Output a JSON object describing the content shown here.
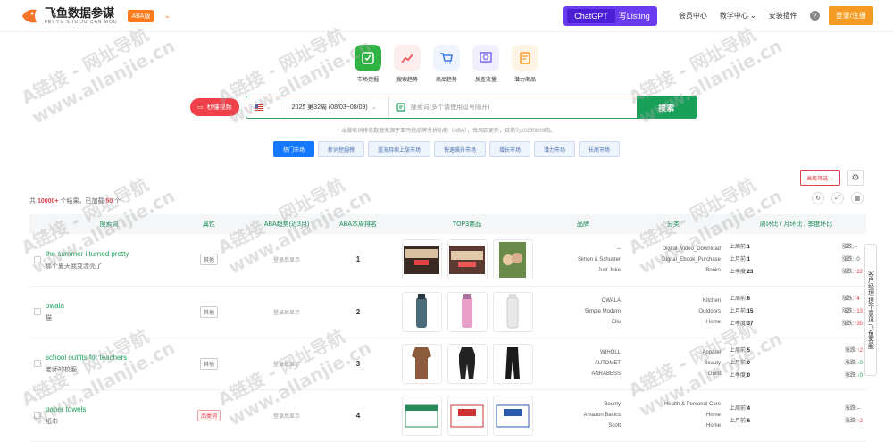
{
  "header": {
    "brand_name": "飞鱼数据参谋",
    "brand_sub": "FEI YU SHU JU CAN MOU",
    "aba_badge": "ABA版",
    "chatgpt": "ChatGPT",
    "write_listing": "写Listing",
    "nav": [
      "会员中心",
      "教学中心",
      "安装插件"
    ],
    "login": "登录/注册"
  },
  "tools": [
    {
      "label": "市场挖掘",
      "color": "#2fb344",
      "bg": "#2fb344",
      "icon": "market-icon"
    },
    {
      "label": "搜索趋势",
      "color": "#f05a5a",
      "bg": "#fdeeee",
      "icon": "trend-icon"
    },
    {
      "label": "商品趋势",
      "color": "#3b7be8",
      "bg": "#eef3fd",
      "icon": "cart-icon"
    },
    {
      "label": "反查流量",
      "color": "#7a6af0",
      "bg": "#f1effd",
      "icon": "reverse-icon"
    },
    {
      "label": "潜力商品",
      "color": "#f59a23",
      "bg": "#fef4e6",
      "icon": "potential-icon"
    }
  ],
  "search": {
    "video_btn": "秒懂视频",
    "week": "2025 第32周 (08/03~08/09)",
    "placeholder": "搜索词(多个请使用逗号隔开)",
    "button": "搜索"
  },
  "notice": "* 本搜索词排名数据来源于亚马逊品牌分析功能（ABA），每周四更新，目前为20250809期。",
  "tabs": [
    "热门市场",
    "新词挖掘榜",
    "蓝海持续上涨市场",
    "快速飙升市场",
    "增长市场",
    "潜力市场",
    "长尾市场"
  ],
  "filter_btn": "高级筛选",
  "stats": {
    "prefix": "共",
    "total": "10000+",
    "mid": "个结果，已加载",
    "loaded": "50",
    "suffix": "个"
  },
  "columns": [
    "",
    "搜索词",
    "属性",
    "ABA趋势(近3月)",
    "ABA本周排名",
    "TOP3商品",
    "品牌",
    "分类",
    "周环比 / 月环比 / 季度环比"
  ],
  "rows": [
    {
      "kw": "the summer i turned pretty",
      "cn": "那个夏天我变漂亮了",
      "attr": "其他",
      "attr_red": false,
      "trend": "登录后显示",
      "rank": "1",
      "brands": [
        "--",
        "Simon & Schuster",
        "Just Juke"
      ],
      "cats": [
        "Digital_Video_Download",
        "Digital_Ebook_Purchase",
        "Books"
      ],
      "r1": "1",
      "r2": "1",
      "r3": "23",
      "c1": "--",
      "c2": "0",
      "c3": "22",
      "d2": "dn",
      "d3": "up"
    },
    {
      "kw": "owala",
      "cn": "猫",
      "attr": "其他",
      "attr_red": false,
      "trend": "登录后显示",
      "rank": "2",
      "brands": [
        "OWALA",
        "Simple Modern",
        "Ello"
      ],
      "cats": [
        "Kitchen",
        "Outdoors",
        "Home"
      ],
      "r1": "6",
      "r2": "15",
      "r3": "37",
      "c1": "4",
      "c2": "13",
      "c3": "35",
      "d2": "up",
      "d3": "up"
    },
    {
      "kw": "school outfits for teachers",
      "cn": "老师的校服",
      "attr": "其他",
      "attr_red": false,
      "trend": "登录后显示",
      "rank": "3",
      "brands": [
        "WIHOLL",
        "AUTOMET",
        "ANRABESS"
      ],
      "cats": [
        "Apparel",
        "Beauty",
        "Guild"
      ],
      "r1": "5",
      "r2": "0",
      "r3": "0",
      "c1": "2",
      "c2": "0",
      "c3": "0",
      "d2": "dn",
      "d3": "dn"
    },
    {
      "kw": "paper towels",
      "cn": "纸巾",
      "attr": "品类词",
      "attr_red": true,
      "trend": "登录后显示",
      "rank": "4",
      "brands": [
        "Bounty",
        "Amazon Basics",
        "Scott"
      ],
      "cats": [
        "Health & Personal Care",
        "Home",
        "Home"
      ],
      "r1": "4",
      "r2": "6",
      "r3": "",
      "c1": "--",
      "c2": "2",
      "c3": "",
      "d2": "up",
      "d3": "up"
    }
  ],
  "side_panel": "客户经理 提个意见 飞鱼客服",
  "watermark": "A链接 - 网址导航",
  "watermark_url": "www.allanjie.cn",
  "rank_labels": {
    "w": "上周前:",
    "m": "上月前:",
    "q": "上季度:",
    "chg": "涨跌:"
  }
}
